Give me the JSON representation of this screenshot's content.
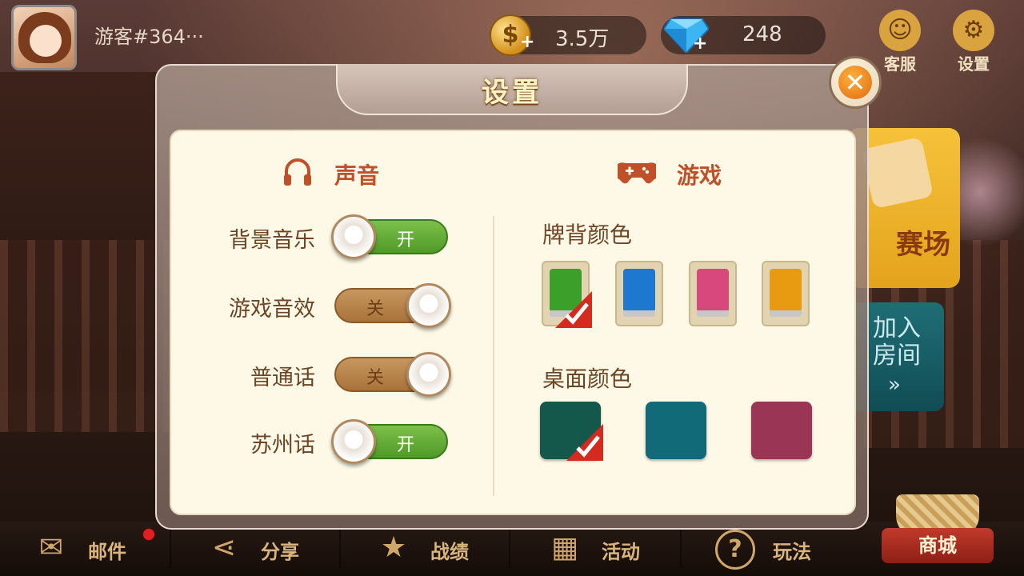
{
  "player": {
    "name": "游客#364···"
  },
  "currency": {
    "coins": {
      "value": "3.5万",
      "symbol": "$",
      "plus": "+"
    },
    "gems": {
      "value": "248",
      "plus": "+"
    }
  },
  "top_buttons": {
    "service": {
      "label": "客服",
      "glyph": "☺"
    },
    "settings": {
      "label": "设置",
      "glyph": "⚙"
    }
  },
  "background_cards": {
    "tournament": {
      "label": "赛场"
    },
    "join_room": {
      "label": "加入房间",
      "arrow": "»"
    }
  },
  "settings_dialog": {
    "title": "设置",
    "close_glyph": "✕",
    "sound": {
      "heading": "声音",
      "toggles": [
        {
          "label": "背景音乐",
          "state": "开",
          "on": true
        },
        {
          "label": "游戏音效",
          "state": "关",
          "on": false
        },
        {
          "label": "普通话",
          "state": "关",
          "on": false
        },
        {
          "label": "苏州话",
          "state": "开",
          "on": true
        }
      ]
    },
    "game": {
      "heading": "游戏",
      "card_back_label": "牌背颜色",
      "card_back_colors": [
        {
          "color": "#3aa02a",
          "selected": true
        },
        {
          "color": "#1e78d0",
          "selected": false
        },
        {
          "color": "#d8487a",
          "selected": false
        },
        {
          "color": "#e89a10",
          "selected": false
        }
      ],
      "table_label": "桌面颜色",
      "table_colors": [
        {
          "color": "#13584a",
          "selected": true
        },
        {
          "color": "#116a78",
          "selected": false
        },
        {
          "color": "#9a3556",
          "selected": false
        }
      ]
    }
  },
  "bottom_nav": [
    {
      "label": "邮件",
      "icon": "mail-icon",
      "glyph": "✉",
      "has_badge": true
    },
    {
      "label": "分享",
      "icon": "share-icon",
      "glyph": "⋖",
      "has_badge": false
    },
    {
      "label": "战绩",
      "icon": "shield-star-icon",
      "glyph": "★",
      "has_badge": false
    },
    {
      "label": "活动",
      "icon": "gift-icon",
      "glyph": "▦",
      "has_badge": false
    },
    {
      "label": "玩法",
      "icon": "question-icon",
      "glyph": "?",
      "has_badge": false
    }
  ],
  "shop": {
    "label": "商城"
  },
  "colors": {
    "accent_red": "#c0502a",
    "label_brown": "#6b4526",
    "panel_bg": "#fdf9e6"
  }
}
